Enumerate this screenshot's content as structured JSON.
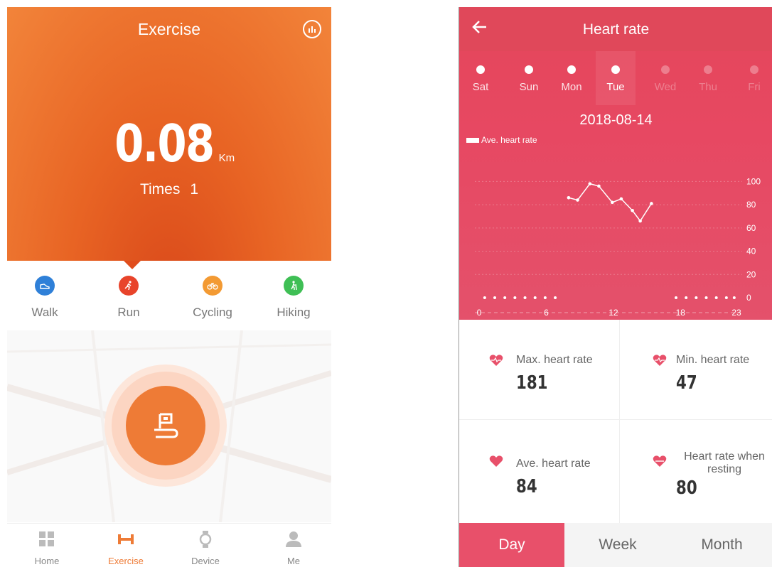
{
  "exercise": {
    "title": "Exercise",
    "distance_value": "0.08",
    "distance_unit": "Km",
    "times_label": "Times",
    "times_value": "1",
    "modes": [
      {
        "label": "Walk",
        "color": "#2f80d8",
        "icon": "shoe-icon"
      },
      {
        "label": "Run",
        "color": "#e8442b",
        "icon": "runner-icon"
      },
      {
        "label": "Cycling",
        "color": "#f39a33",
        "icon": "bicycle-icon"
      },
      {
        "label": "Hiking",
        "color": "#3fbf55",
        "icon": "hiker-icon"
      }
    ],
    "nav": [
      {
        "label": "Home",
        "icon": "grid-icon"
      },
      {
        "label": "Exercise",
        "icon": "dumbbell-icon"
      },
      {
        "label": "Device",
        "icon": "watch-icon"
      },
      {
        "label": "Me",
        "icon": "person-icon"
      }
    ],
    "accent": "#ee7b36"
  },
  "heart_rate": {
    "title": "Heart rate",
    "days": [
      "Sat",
      "Sun",
      "Mon",
      "Tue",
      "Wed",
      "Thu",
      "Fri"
    ],
    "selected_day": "Tue",
    "date": "2018-08-14",
    "legend": "Ave. heart rate",
    "chart_data": {
      "type": "line",
      "x_ticks": [
        "0",
        "6",
        "12",
        "18",
        "23"
      ],
      "y_ticks": [
        "0",
        "20",
        "40",
        "60",
        "80",
        "100"
      ],
      "ylim": [
        0,
        110
      ],
      "xlim": [
        0,
        23
      ],
      "points": [
        {
          "x": 8.0,
          "y": 86
        },
        {
          "x": 8.8,
          "y": 84
        },
        {
          "x": 9.9,
          "y": 98
        },
        {
          "x": 10.7,
          "y": 96
        },
        {
          "x": 11.9,
          "y": 82
        },
        {
          "x": 12.7,
          "y": 85
        },
        {
          "x": 13.7,
          "y": 75
        },
        {
          "x": 14.4,
          "y": 66
        },
        {
          "x": 15.4,
          "y": 81
        }
      ],
      "zero_points_left": [
        0.5,
        1.4,
        2.3,
        3.2,
        4.1,
        5.0,
        5.9,
        6.8
      ],
      "zero_points_right": [
        17.6,
        18.5,
        19.4,
        20.3,
        21.2,
        22.1,
        22.8
      ]
    },
    "stats": {
      "max_label": "Max. heart rate",
      "max_value": "181",
      "min_label": "Min. heart rate",
      "min_value": "47",
      "ave_label": "Ave. heart rate",
      "ave_value": "84",
      "rest_label_1": "Heart rate when",
      "rest_label_2": "resting",
      "rest_value": "80"
    },
    "tabs": [
      "Day",
      "Week",
      "Month"
    ],
    "active_tab": "Day",
    "accent": "#e8506a"
  }
}
